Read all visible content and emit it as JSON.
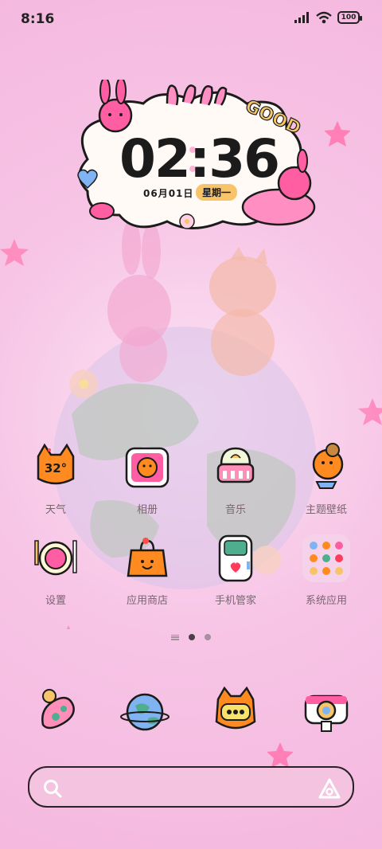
{
  "status_bar": {
    "time": "8:16",
    "battery": "100",
    "icons": [
      "signal-icon",
      "wifi-icon",
      "battery-icon"
    ]
  },
  "clock_widget": {
    "time": "02:36",
    "date": "06月01日",
    "weekday": "星期一",
    "sticker_text": "GOOD"
  },
  "apps": [
    {
      "label": "天气",
      "icon": "weather-icon",
      "temp": "32°"
    },
    {
      "label": "相册",
      "icon": "gallery-icon"
    },
    {
      "label": "音乐",
      "icon": "music-icon"
    },
    {
      "label": "主题壁纸",
      "icon": "theme-icon"
    },
    {
      "label": "设置",
      "icon": "settings-icon"
    },
    {
      "label": "应用商店",
      "icon": "app-store-icon"
    },
    {
      "label": "手机管家",
      "icon": "phone-manager-icon"
    },
    {
      "label": "系统应用",
      "icon": "system-apps-folder-icon"
    }
  ],
  "page_indicator": {
    "pages": 2,
    "current": 1
  },
  "dock": [
    "phone-icon",
    "browser-icon",
    "messages-icon",
    "camera-icon"
  ],
  "colors": {
    "background": "#f5b8df",
    "accent": "#ff5fa2",
    "text": "#7a6570"
  }
}
